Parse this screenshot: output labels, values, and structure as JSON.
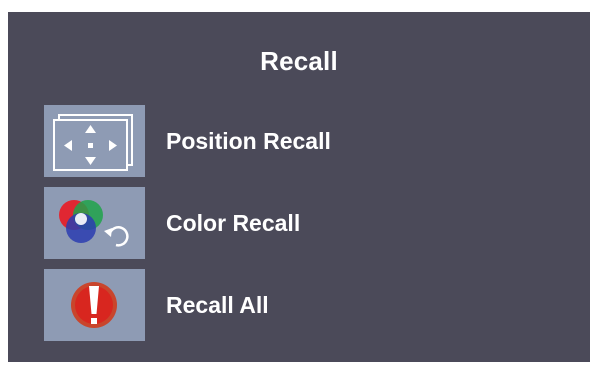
{
  "osd": {
    "title": "Recall",
    "background_color": "#4b4a59",
    "icon_bg_color": "#8e9bb4",
    "text_color": "#ffffff",
    "items": [
      {
        "label": "Position Recall",
        "icon": "position-arrows-icon"
      },
      {
        "label": "Color Recall",
        "icon": "color-recall-icon"
      },
      {
        "label": "Recall All",
        "icon": "recall-all-exclamation-icon"
      }
    ]
  }
}
